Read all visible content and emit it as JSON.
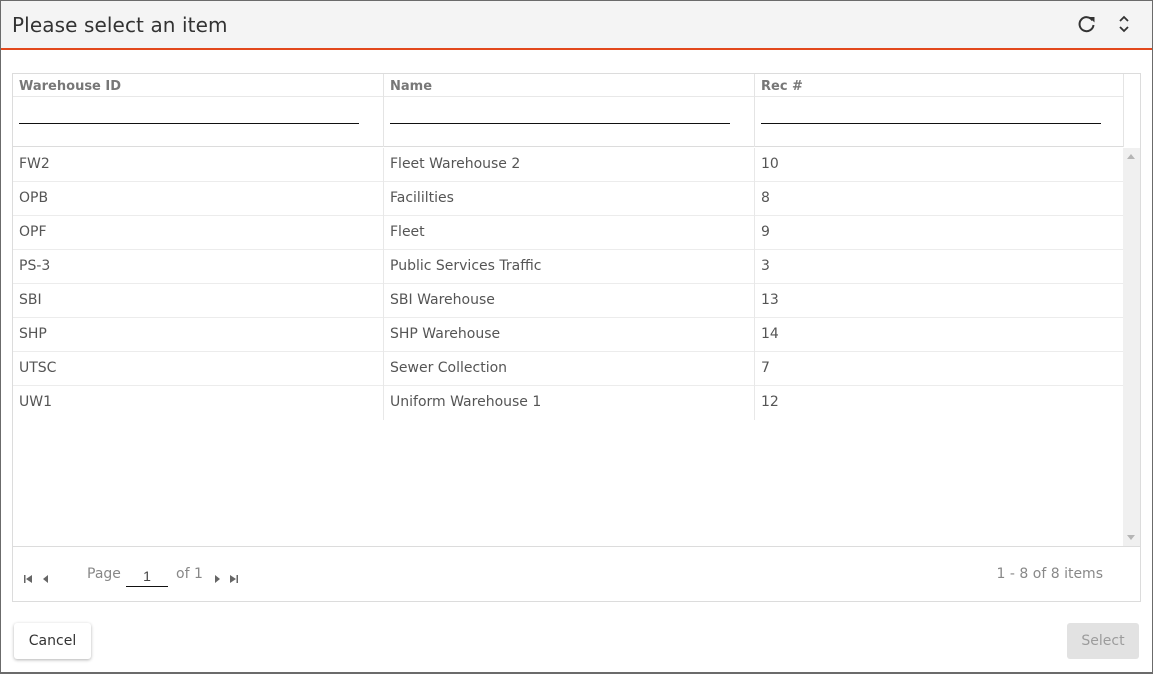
{
  "dialog": {
    "title": "Please select an item",
    "accent_color": "#e2481c",
    "header_icons": [
      "refresh-icon",
      "expand-collapse-icon"
    ]
  },
  "grid": {
    "columns": [
      {
        "key": "warehouse_id",
        "label": "Warehouse ID",
        "filter_value": ""
      },
      {
        "key": "name",
        "label": "Name",
        "filter_value": ""
      },
      {
        "key": "rec",
        "label": "Rec #",
        "filter_value": ""
      }
    ],
    "rows": [
      {
        "warehouse_id": "FW2",
        "name": "Fleet Warehouse 2",
        "rec": "10"
      },
      {
        "warehouse_id": "OPB",
        "name": "Facililties",
        "rec": "8"
      },
      {
        "warehouse_id": "OPF",
        "name": "Fleet",
        "rec": "9"
      },
      {
        "warehouse_id": "PS-3",
        "name": "Public Services Traffic",
        "rec": "3"
      },
      {
        "warehouse_id": "SBI",
        "name": "SBI Warehouse",
        "rec": "13"
      },
      {
        "warehouse_id": "SHP",
        "name": "SHP Warehouse",
        "rec": "14"
      },
      {
        "warehouse_id": "UTSC",
        "name": "Sewer Collection",
        "rec": "7"
      },
      {
        "warehouse_id": "UW1",
        "name": "Uniform Warehouse 1",
        "rec": "12"
      }
    ]
  },
  "pager": {
    "page_label": "Page",
    "page_value": "1",
    "of_label": "of 1",
    "info": "1 - 8 of 8 items"
  },
  "footer": {
    "cancel_label": "Cancel",
    "select_label": "Select"
  }
}
